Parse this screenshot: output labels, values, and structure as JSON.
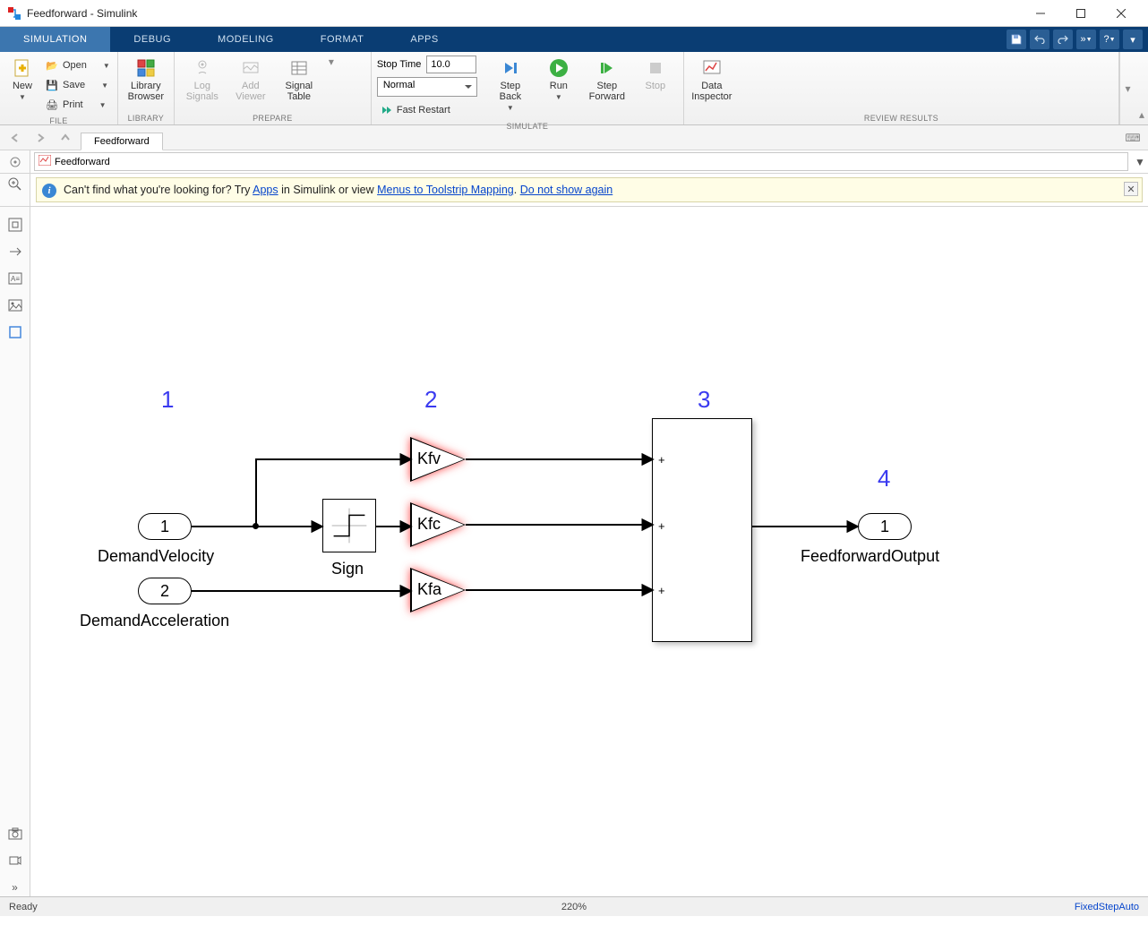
{
  "window": {
    "title": "Feedforward - Simulink"
  },
  "tabs": {
    "simulation": "SIMULATION",
    "debug": "DEBUG",
    "modeling": "MODELING",
    "format": "FORMAT",
    "apps": "APPS"
  },
  "ribbon": {
    "file": {
      "new": "New",
      "open": "Open",
      "save": "Save",
      "print": "Print",
      "group": "FILE"
    },
    "library": {
      "browser": "Library\nBrowser",
      "group": "LIBRARY"
    },
    "prepare": {
      "log": "Log\nSignals",
      "addviewer": "Add\nViewer",
      "sigtable": "Signal\nTable",
      "group": "PREPARE"
    },
    "simulate": {
      "stoptime_label": "Stop Time",
      "stoptime_value": "10.0",
      "mode": "Normal",
      "fastrestart": "Fast Restart",
      "stepback": "Step\nBack",
      "run": "Run",
      "stepfwd": "Step\nForward",
      "stop": "Stop",
      "group": "SIMULATE"
    },
    "review": {
      "datainspector": "Data\nInspector",
      "group": "REVIEW RESULTS"
    }
  },
  "nav": {
    "tab": "Feedforward",
    "path": "Feedforward"
  },
  "banner": {
    "prefix": "Can't find what you're looking for? Try ",
    "link1": "Apps",
    "mid1": " in Simulink or view ",
    "link2": "Menus to Toolstrip Mapping",
    "mid2": ". ",
    "link3": "Do not show again"
  },
  "diagram": {
    "annotations": {
      "a1": "1",
      "a2": "2",
      "a3": "3",
      "a4": "4"
    },
    "in1_num": "1",
    "in1_label": "DemandVelocity",
    "in2_num": "2",
    "in2_label": "DemandAcceleration",
    "sign_label": "Sign",
    "gain_kfv": "Kfv",
    "gain_kfc": "Kfc",
    "gain_kfa": "Kfa",
    "sum_plus": "+",
    "out1_num": "1",
    "out1_label": "FeedforwardOutput"
  },
  "status": {
    "ready": "Ready",
    "zoom": "220%",
    "solver": "FixedStepAuto"
  }
}
